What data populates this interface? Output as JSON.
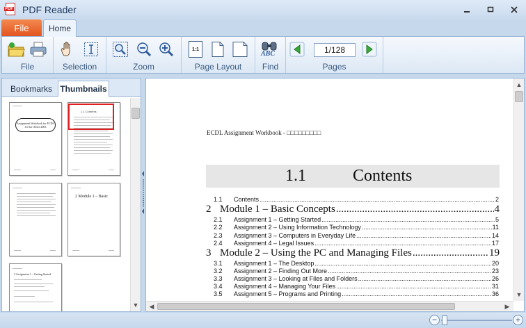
{
  "window": {
    "title": "PDF Reader",
    "icon_label": "PDF"
  },
  "ribbon_tabs": {
    "file": "File",
    "home": "Home"
  },
  "ribbon": {
    "groups": {
      "file": "File",
      "selection": "Selection",
      "zoom": "Zoom",
      "page_layout": "Page Layout",
      "find": "Find",
      "pages": "Pages"
    },
    "page_layout_single": "1:1",
    "find_icon_text": "ABC",
    "page_indicator": "1/128"
  },
  "left_panel": {
    "tabs": {
      "bookmarks": "Bookmarks",
      "thumbnails": "Thumbnails"
    },
    "thumbnails": [
      {
        "text": "Assignment Workbook for ECDL 4.0 for Office 2003"
      },
      {
        "text": "1.1 Contents",
        "selected": true
      },
      {
        "text": ""
      },
      {
        "text": "2 Module 1 – Basic"
      },
      {
        "text": "3 Assignment 1 – Getting Started"
      }
    ]
  },
  "document": {
    "header": "ECDL Assignment Workbook - □□□□□□□□□",
    "contents_number": "1.1",
    "contents_title": "Contents",
    "toc": [
      {
        "level": 2,
        "num": "1.1",
        "title": "Contents",
        "page": "2"
      },
      {
        "level": 1,
        "num": "2",
        "title": "Module 1 – Basic Concepts",
        "page": "4"
      },
      {
        "level": 2,
        "num": "2.1",
        "title": "Assignment 1 – Getting Started",
        "page": "5"
      },
      {
        "level": 2,
        "num": "2.2",
        "title": "Assignment 2 – Using Information Technology",
        "page": "11"
      },
      {
        "level": 2,
        "num": "2.3",
        "title": "Assignment 3 – Computers in Everyday Life",
        "page": "14"
      },
      {
        "level": 2,
        "num": "2.4",
        "title": "Assignment 4 – Legal Issues",
        "page": "17"
      },
      {
        "level": 1,
        "num": "3",
        "title": "Module 2 – Using the PC and Managing Files",
        "page": "19"
      },
      {
        "level": 2,
        "num": "3.1",
        "title": "Assignment 1 – The Desktop",
        "page": "20"
      },
      {
        "level": 2,
        "num": "3.2",
        "title": "Assignment 2 – Finding Out More",
        "page": "23"
      },
      {
        "level": 2,
        "num": "3.3",
        "title": "Assignment 3 – Looking at Files and Folders",
        "page": "26"
      },
      {
        "level": 2,
        "num": "3.4",
        "title": "Assignment 4 – Managing Your Files",
        "page": "31"
      },
      {
        "level": 2,
        "num": "3.5",
        "title": "Assignment 5 – Programs and Printing",
        "page": "36"
      }
    ]
  },
  "status": {
    "zoom_minus": "−",
    "zoom_plus": "+"
  }
}
